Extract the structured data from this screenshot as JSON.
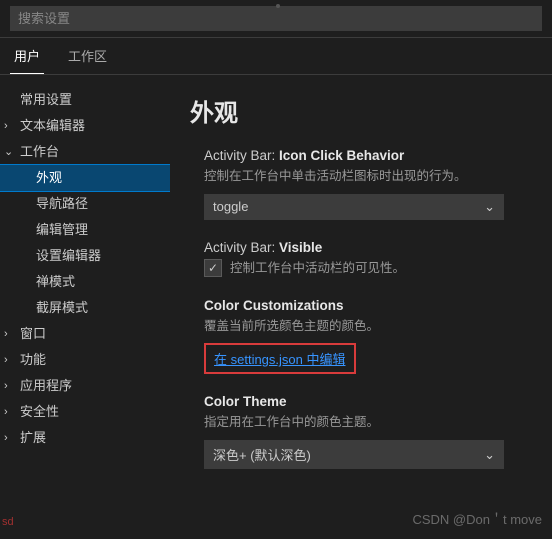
{
  "search": {
    "placeholder": "搜索设置"
  },
  "tabs": {
    "user": "用户",
    "workspace": "工作区"
  },
  "sidebar": {
    "common": "常用设置",
    "textEditor": "文本编辑器",
    "workbench": "工作台",
    "appearance": "外观",
    "breadcrumb": "导航路径",
    "editorMgmt": "编辑管理",
    "settingsEditor": "设置编辑器",
    "zenMode": "禅模式",
    "screencast": "截屏模式",
    "window": "窗口",
    "features": "功能",
    "application": "应用程序",
    "security": "安全性",
    "extensions": "扩展"
  },
  "content": {
    "heading": "外观",
    "activityBarIcon": {
      "group": "Activity Bar: ",
      "name": "Icon Click Behavior",
      "desc": "控制在工作台中单击活动栏图标时出现的行为。",
      "value": "toggle"
    },
    "activityBarVisible": {
      "group": "Activity Bar: ",
      "name": "Visible",
      "desc": "控制工作台中活动栏的可见性。",
      "checked": true
    },
    "colorCustom": {
      "name": "Color Customizations",
      "desc": "覆盖当前所选颜色主题的颜色。",
      "link": "在 settings.json 中编辑"
    },
    "colorTheme": {
      "name": "Color Theme",
      "desc": "指定用在工作台中的颜色主题。",
      "value": "深色+ (默认深色)"
    }
  },
  "watermark": "CSDN @Don＇t move",
  "sd": "sd"
}
